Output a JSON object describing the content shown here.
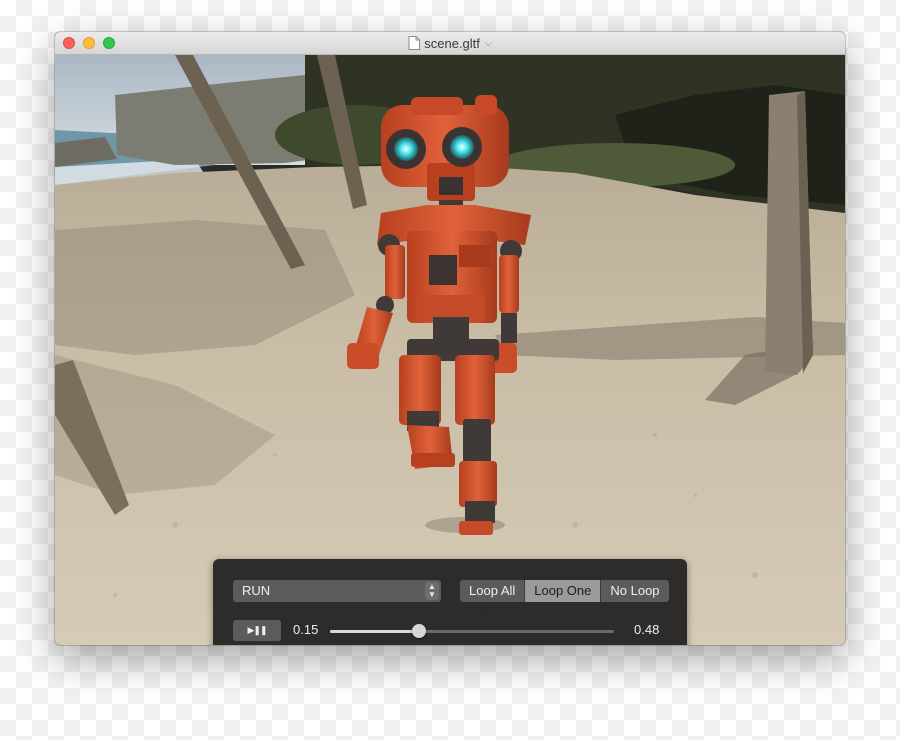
{
  "window": {
    "title": "scene.gltf",
    "title_icon": "document-icon",
    "title_menu_icon": "chevron-down-icon"
  },
  "viewport": {
    "content": "3D scene render of a robot on a sandy beach",
    "colors": {
      "sand": "#cbbfa6",
      "robot": "#d24f2a",
      "eyes": "#3fe0e6"
    }
  },
  "controls": {
    "animation_select": {
      "value": "RUN",
      "icon": "up-down-arrows-icon"
    },
    "loop_modes": [
      "Loop All",
      "Loop One",
      "No Loop"
    ],
    "loop_selected": "Loop One",
    "play_pause": {
      "label": "▶❚❚",
      "icon": "play-pause-icon"
    },
    "current_time": "0.15",
    "total_time": "0.48",
    "progress": 0.3125
  }
}
